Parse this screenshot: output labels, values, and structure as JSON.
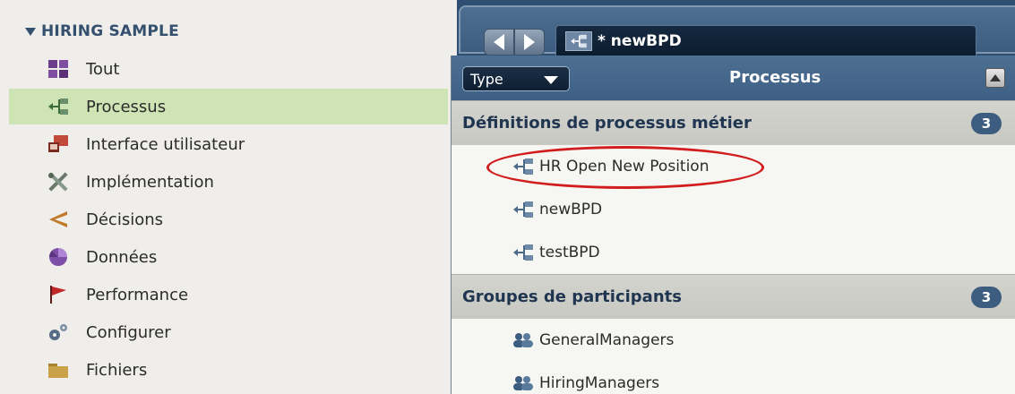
{
  "library": {
    "title": "HIRING SAMPLE",
    "items": [
      {
        "label": "Tout",
        "icon": "grid-icon"
      },
      {
        "label": "Processus",
        "icon": "process-icon",
        "selected": true
      },
      {
        "label": "Interface utilisateur",
        "icon": "user-interface-icon"
      },
      {
        "label": "Implémentation",
        "icon": "tools-icon"
      },
      {
        "label": "Décisions",
        "icon": "decision-icon"
      },
      {
        "label": "Données",
        "icon": "data-icon"
      },
      {
        "label": "Performance",
        "icon": "flag-icon"
      },
      {
        "label": "Configurer",
        "icon": "gears-icon"
      },
      {
        "label": "Fichiers",
        "icon": "folder-icon"
      }
    ]
  },
  "editor": {
    "tab_label": "* newBPD"
  },
  "panel": {
    "type_label": "Type",
    "title": "Processus",
    "sections": [
      {
        "label": "Définitions de processus métier",
        "count": "3",
        "items": [
          "HR Open New Position",
          "newBPD",
          "testBPD"
        ]
      },
      {
        "label": "Groupes de participants",
        "count": "3",
        "items": [
          "GeneralManagers",
          "HiringManagers"
        ]
      }
    ]
  },
  "colors": {
    "selected_bg": "#cfe4b5",
    "header_blue": "#3e6085",
    "highlight_red": "#d11d1d"
  }
}
